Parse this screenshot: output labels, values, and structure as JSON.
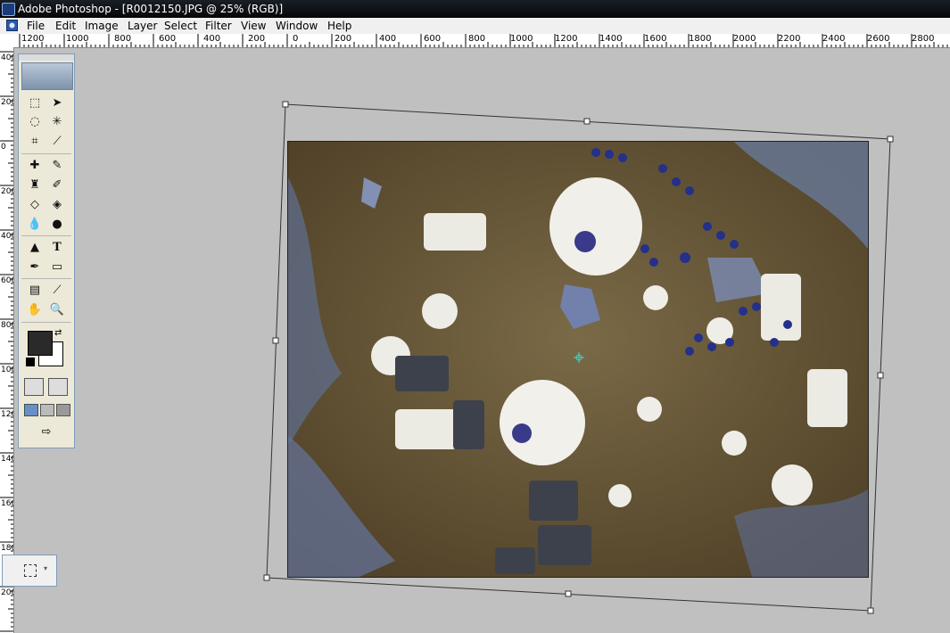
{
  "window": {
    "title": "Adobe Photoshop - [R0012150.JPG @ 25% (RGB)]"
  },
  "menu": [
    "File",
    "Edit",
    "Image",
    "Layer",
    "Select",
    "Filter",
    "View",
    "Window",
    "Help"
  ],
  "ruler_top": [
    "1200",
    "1000",
    "800",
    "600",
    "400",
    "200",
    "0",
    "200",
    "400",
    "600",
    "800",
    "1000",
    "1200",
    "1400",
    "1600",
    "1800",
    "2000",
    "2200",
    "2400",
    "2600",
    "2800"
  ],
  "ruler_left": [
    "400",
    "200",
    "0",
    "200",
    "400",
    "600",
    "800",
    "1000",
    "1200",
    "1400",
    "1600",
    "1800",
    "2000"
  ],
  "toolbox": {
    "tools": [
      "rectangular-marquee",
      "move",
      "lasso",
      "magic-wand",
      "crop",
      "slice",
      "healing-brush",
      "brush",
      "clone-stamp",
      "history-brush",
      "eraser",
      "paint-bucket",
      "blur",
      "dodge",
      "path-selection",
      "type",
      "pen",
      "rectangle-shape",
      "notes",
      "eyedropper",
      "hand",
      "zoom"
    ],
    "type_tool_glyph": "T",
    "foreground_color": "#2a2a2a",
    "background_color": "#ffffff"
  },
  "document": {
    "name": "R0012150.JPG",
    "zoom": "25%",
    "mode": "RGB"
  },
  "colors": {
    "titlebar": "#0a0d12",
    "workspace": "#c0c0c0",
    "photo_ground": "#6e5c3b"
  }
}
